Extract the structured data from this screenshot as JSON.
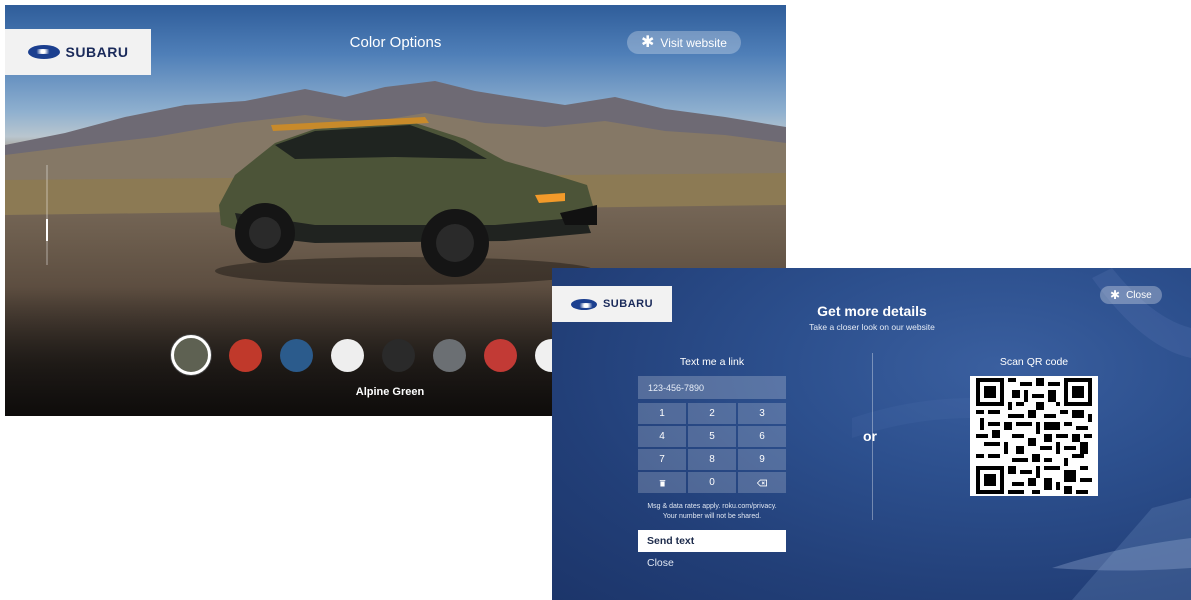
{
  "screen1": {
    "brand": "SUBARU",
    "title": "Color Options",
    "visit_label": "Visit website",
    "selected_color_name": "Alpine Green",
    "swatches": [
      "#5e6152",
      "#c0392b",
      "#2b5b8c",
      "#eeeeee",
      "#2a2a2a",
      "#6b6f73",
      "#c23a35",
      "#f0f0f0"
    ]
  },
  "screen2": {
    "brand": "SUBARU",
    "close_pill_label": "Close",
    "title": "Get more details",
    "subtitle": "Take a closer look on our website",
    "text_section_title": "Text me a link",
    "phone_placeholder": "123-456-7890",
    "keys": [
      "1",
      "2",
      "3",
      "4",
      "5",
      "6",
      "7",
      "8",
      "9",
      "",
      "0",
      ""
    ],
    "disclaimer_line1": "Msg & data rates apply. roku.com/privacy.",
    "disclaimer_line2": "Your number will not be shared.",
    "send_label": "Send text",
    "close_label": "Close",
    "or_label": "or",
    "qr_section_title": "Scan QR code"
  }
}
